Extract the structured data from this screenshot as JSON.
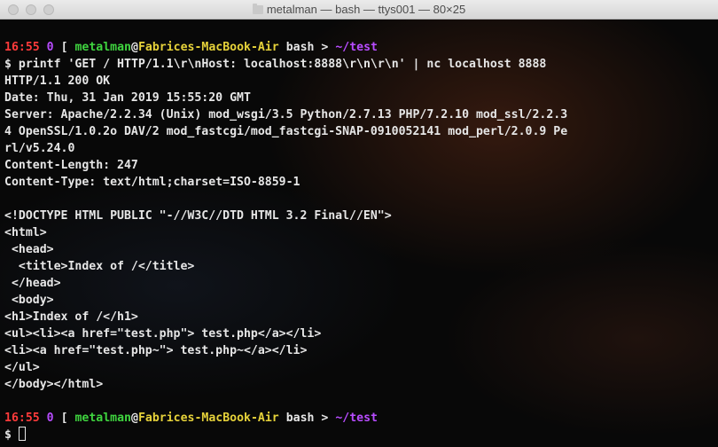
{
  "window": {
    "title": "metalman — bash — ttys001 — 80×25"
  },
  "prompt": {
    "time": "16:55",
    "exit": "0",
    "open": "[",
    "user": "metalman",
    "at": "@",
    "host": "Fabrices-MacBook-Air",
    "shell": "bash",
    "arrow": ">",
    "cwd": "~/test",
    "dollar": "$"
  },
  "command": "printf 'GET / HTTP/1.1\\r\\nHost: localhost:8888\\r\\n\\r\\n' | nc localhost 8888",
  "output": [
    "HTTP/1.1 200 OK",
    "Date: Thu, 31 Jan 2019 15:55:20 GMT",
    "Server: Apache/2.2.34 (Unix) mod_wsgi/3.5 Python/2.7.13 PHP/7.2.10 mod_ssl/2.2.3",
    "4 OpenSSL/1.0.2o DAV/2 mod_fastcgi/mod_fastcgi-SNAP-0910052141 mod_perl/2.0.9 Pe",
    "rl/v5.24.0",
    "Content-Length: 247",
    "Content-Type: text/html;charset=ISO-8859-1",
    "",
    "<!DOCTYPE HTML PUBLIC \"-//W3C//DTD HTML 3.2 Final//EN\">",
    "<html>",
    " <head>",
    "  <title>Index of /</title>",
    " </head>",
    " <body>",
    "<h1>Index of /</h1>",
    "<ul><li><a href=\"test.php\"> test.php</a></li>",
    "<li><a href=\"test.php~\"> test.php~</a></li>",
    "</ul>",
    "</body></html>",
    ""
  ],
  "colors": {
    "time": "#ff3b3b",
    "exit": "#b84cff",
    "user": "#3fd43f",
    "host": "#e6d23a",
    "cwd": "#b84cff",
    "text": "#e6e6e6"
  }
}
